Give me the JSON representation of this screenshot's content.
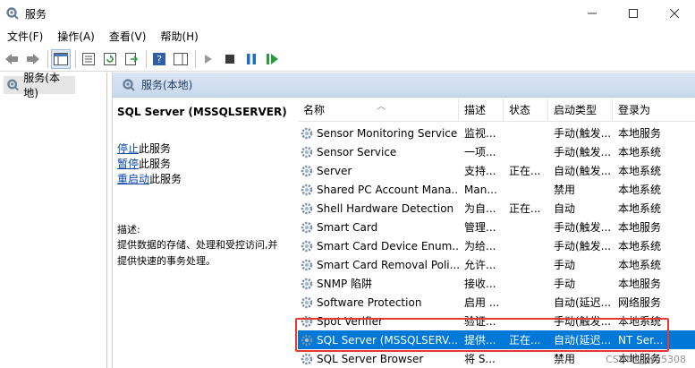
{
  "window": {
    "title": "服务"
  },
  "menu": [
    "文件(F)",
    "操作(A)",
    "查看(V)",
    "帮助(H)"
  ],
  "tree": {
    "root_label": "服务(本地)"
  },
  "panel": {
    "header_label": "服务(本地)"
  },
  "detail": {
    "service_title": "SQL Server (MSSQLSERVER)",
    "actions": [
      {
        "link": "停止",
        "suffix": "此服务"
      },
      {
        "link": "暂停",
        "suffix": "此服务"
      },
      {
        "link": "重启动",
        "suffix": "此服务"
      }
    ],
    "description_label": "描述:",
    "description_text": "提供数据的存储、处理和受控访问,并提供快速的事务处理。"
  },
  "table": {
    "columns": [
      "名称",
      "描述",
      "状态",
      "启动类型",
      "登录为"
    ],
    "rows": [
      {
        "name": "Sensor Monitoring Service",
        "desc": "监视...",
        "status": "",
        "startup": "手动(触发...",
        "logon": "本地服务"
      },
      {
        "name": "Sensor Service",
        "desc": "一项...",
        "status": "",
        "startup": "手动(触发...",
        "logon": "本地系统"
      },
      {
        "name": "Server",
        "desc": "支持...",
        "status": "正在...",
        "startup": "自动(触发...",
        "logon": "本地系统"
      },
      {
        "name": "Shared PC Account Mana...",
        "desc": "Man...",
        "status": "",
        "startup": "禁用",
        "logon": "本地系统"
      },
      {
        "name": "Shell Hardware Detection",
        "desc": "为自...",
        "status": "正在...",
        "startup": "自动",
        "logon": "本地系统"
      },
      {
        "name": "Smart Card",
        "desc": "管理...",
        "status": "",
        "startup": "手动(触发...",
        "logon": "本地服务"
      },
      {
        "name": "Smart Card Device Enum...",
        "desc": "为给...",
        "status": "",
        "startup": "手动(触发...",
        "logon": "本地系统"
      },
      {
        "name": "Smart Card Removal Poli...",
        "desc": "允许...",
        "status": "",
        "startup": "手动",
        "logon": "本地系统"
      },
      {
        "name": "SNMP 陷阱",
        "desc": "接收...",
        "status": "",
        "startup": "手动",
        "logon": "本地服务"
      },
      {
        "name": "Software Protection",
        "desc": "启用 ...",
        "status": "",
        "startup": "自动(延迟...",
        "logon": "网络服务"
      },
      {
        "name": "Spot Verifier",
        "desc": "验证...",
        "status": "",
        "startup": "手动(触发...",
        "logon": "本地系统"
      },
      {
        "name": "SQL Server (MSSQLSERV...",
        "desc": "提供...",
        "status": "正在...",
        "startup": "自动(延迟...",
        "logon": "NT Ser..."
      },
      {
        "name": "SQL Server Browser",
        "desc": "将 S...",
        "status": "",
        "startup": "禁用",
        "logon": "本地服务"
      }
    ],
    "selected_index": 11
  },
  "watermark": "CSDN @wu5308",
  "colors": {
    "selection": "#0078d7",
    "highlight": "#e53935",
    "link": "#0645ad"
  }
}
